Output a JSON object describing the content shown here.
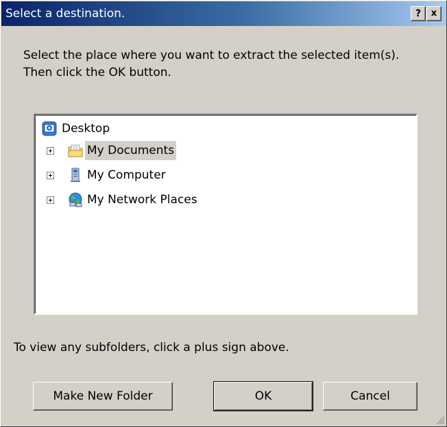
{
  "window": {
    "title": "Select a destination.",
    "help_label": "?",
    "close_label": "x"
  },
  "instruction": "Select the place where you want to extract the selected item(s).  Then click the OK button.",
  "tree": {
    "root": {
      "label": "Desktop",
      "icon": "desktop-icon"
    },
    "items": [
      {
        "label": "My Documents",
        "icon": "documents-folder-icon",
        "selected": true
      },
      {
        "label": "My Computer",
        "icon": "computer-icon",
        "selected": false
      },
      {
        "label": "My Network Places",
        "icon": "network-places-icon",
        "selected": false
      }
    ]
  },
  "hint": "To view any subfolders, click a plus sign above.",
  "buttons": {
    "new_folder": "Make New Folder",
    "ok": "OK",
    "cancel": "Cancel"
  },
  "colors": {
    "dialog_face": "#d4d0c8",
    "title_gradient_start": "#0a246a",
    "title_gradient_end": "#a6caf0"
  }
}
